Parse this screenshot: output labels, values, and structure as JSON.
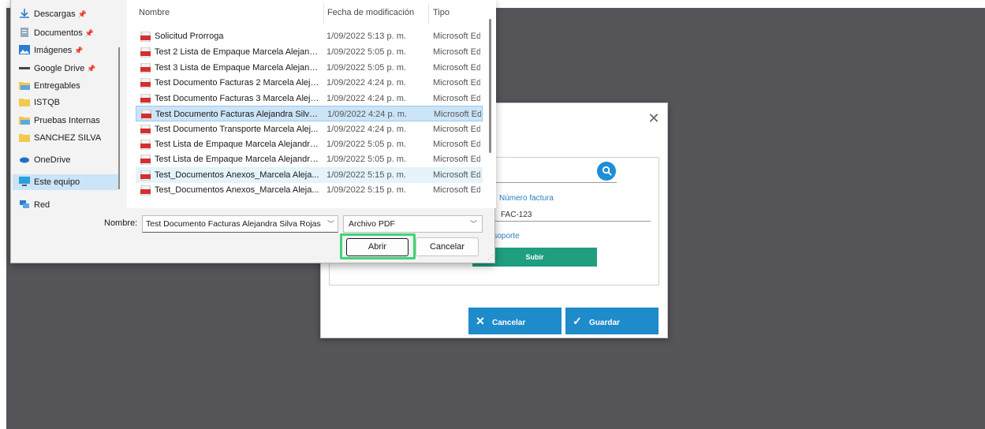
{
  "colors": {
    "backdrop": "#56555a",
    "accent_blue": "#1e8bcb",
    "accent_green": "#1f9e80",
    "focus_ring": "#3ed476",
    "selection": "#cce4f7"
  },
  "dialog": {
    "nav": [
      {
        "label": "Descargas",
        "icon": "download-icon",
        "pinned": true
      },
      {
        "label": "Documentos",
        "icon": "documents-icon",
        "pinned": true
      },
      {
        "label": "Imágenes",
        "icon": "images-icon",
        "pinned": true
      },
      {
        "label": "Google Drive",
        "icon": "drive-icon",
        "pinned": true
      },
      {
        "label": "Entregables",
        "icon": "folder-icon",
        "pinned": false
      },
      {
        "label": "ISTQB",
        "icon": "folder-icon",
        "pinned": false
      },
      {
        "label": "Pruebas Internas",
        "icon": "folder-icon",
        "pinned": false
      },
      {
        "label": "SANCHEZ SILVA",
        "icon": "folder-icon",
        "pinned": false
      },
      {
        "label": "OneDrive",
        "icon": "onedrive-icon",
        "pinned": false
      },
      {
        "label": "Este equipo",
        "icon": "computer-icon",
        "pinned": false
      },
      {
        "label": "Red",
        "icon": "network-icon",
        "pinned": false
      }
    ],
    "columns": {
      "name": "Nombre",
      "date": "Fecha de modificación",
      "type": "Tipo"
    },
    "files": [
      {
        "name": "Solicitud Prorroga",
        "date": "1/09/2022 5:13 p. m.",
        "type": "Microsoft Ed"
      },
      {
        "name": "Test 2 Lista de Empaque Marcela Alejandr...",
        "date": "1/09/2022 5:05 p. m.",
        "type": "Microsoft Ed"
      },
      {
        "name": "Test 3 Lista de Empaque Marcela Alejandr...",
        "date": "1/09/2022 5:05 p. m.",
        "type": "Microsoft Ed"
      },
      {
        "name": "Test Documento Facturas 2 Marcela Aleja...",
        "date": "1/09/2022 4:24 p. m.",
        "type": "Microsoft Ed"
      },
      {
        "name": "Test Documento Facturas 3 Marcela Aleja...",
        "date": "1/09/2022 4:24 p. m.",
        "type": "Microsoft Ed"
      },
      {
        "name": "Test Documento Facturas Alejandra Silva ...",
        "date": "1/09/2022 4:24 p. m.",
        "type": "Microsoft Ed"
      },
      {
        "name": "Test Documento Transporte Marcela Alej...",
        "date": "1/09/2022 4:24 p. m.",
        "type": "Microsoft Ed"
      },
      {
        "name": "Test Lista de Empaque Marcela Alejandra ...",
        "date": "1/09/2022 5:05 p. m.",
        "type": "Microsoft Ed"
      },
      {
        "name": "Test Lista de Empaque Marcela Alejandra ...",
        "date": "1/09/2022 5:05 p. m.",
        "type": "Microsoft Ed"
      },
      {
        "name": "Test_Documentos Anexos_Marcela Aleja...",
        "date": "1/09/2022 5:15 p. m.",
        "type": "Microsoft Ed"
      },
      {
        "name": "Test_Documentos Anexos_Marcela Aleja...",
        "date": "1/09/2022 5:15 p. m.",
        "type": "Microsoft Ed"
      }
    ],
    "filename_label": "Nombre:",
    "filename_value": "Test Documento Facturas Alejandra Silva Rojas",
    "filetype_value": "Archivo PDF",
    "open_label": "Abrir",
    "cancel_label": "Cancelar"
  },
  "modal": {
    "invoice_label": "Número factura",
    "invoice_value": "FAC-123",
    "support_label": "o soporte",
    "upload_label": "Subir",
    "cancel_label": "Cancelar",
    "save_label": "Guardar"
  }
}
